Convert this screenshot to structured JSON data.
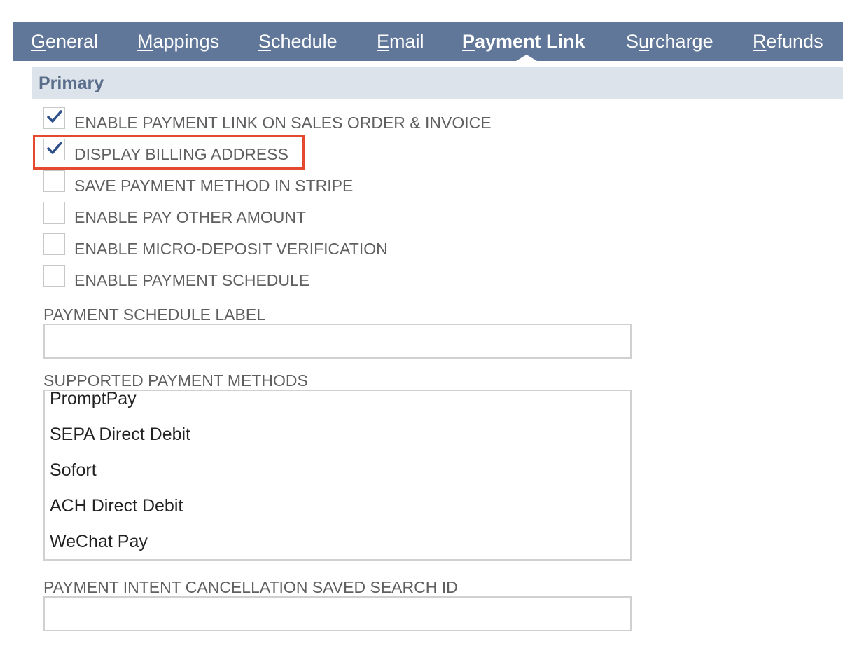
{
  "tabs": [
    {
      "prefix": "",
      "accel": "G",
      "rest": "eneral"
    },
    {
      "prefix": "",
      "accel": "M",
      "rest": "appings"
    },
    {
      "prefix": "",
      "accel": "S",
      "rest": "chedule"
    },
    {
      "prefix": "",
      "accel": "E",
      "rest": "mail"
    },
    {
      "prefix": "",
      "accel": "P",
      "rest": "ayment Link",
      "active": true
    },
    {
      "prefix": "S",
      "accel": "u",
      "rest": "rcharge"
    },
    {
      "prefix": "",
      "accel": "R",
      "rest": "efunds"
    }
  ],
  "section": {
    "title": "Primary"
  },
  "checkboxes": [
    {
      "label": "ENABLE PAYMENT LINK ON SALES ORDER & INVOICE",
      "checked": true
    },
    {
      "label": "DISPLAY BILLING ADDRESS",
      "checked": true
    },
    {
      "label": "SAVE PAYMENT METHOD IN STRIPE",
      "checked": false
    },
    {
      "label": "ENABLE PAY OTHER AMOUNT",
      "checked": false
    },
    {
      "label": "ENABLE MICRO-DEPOSIT VERIFICATION",
      "checked": false
    },
    {
      "label": "ENABLE PAYMENT SCHEDULE",
      "checked": false
    }
  ],
  "fields": {
    "payment_schedule_label": {
      "label": "PAYMENT SCHEDULE LABEL",
      "value": ""
    },
    "supported_payment_methods": {
      "label": "SUPPORTED PAYMENT METHODS",
      "options": [
        "PromptPay",
        "SEPA Direct Debit",
        "Sofort",
        "ACH Direct Debit",
        "WeChat Pay"
      ]
    },
    "payment_intent_cancellation": {
      "label": "PAYMENT INTENT CANCELLATION SAVED SEARCH ID",
      "value": ""
    }
  },
  "colors": {
    "tab_bar": "#607799",
    "section_bg": "#dde3ea",
    "section_title": "#5a6e8c",
    "check_mark": "#2d4f8a",
    "highlight": "#e54930"
  },
  "icons": {
    "checkmark": "checkmark-icon"
  }
}
